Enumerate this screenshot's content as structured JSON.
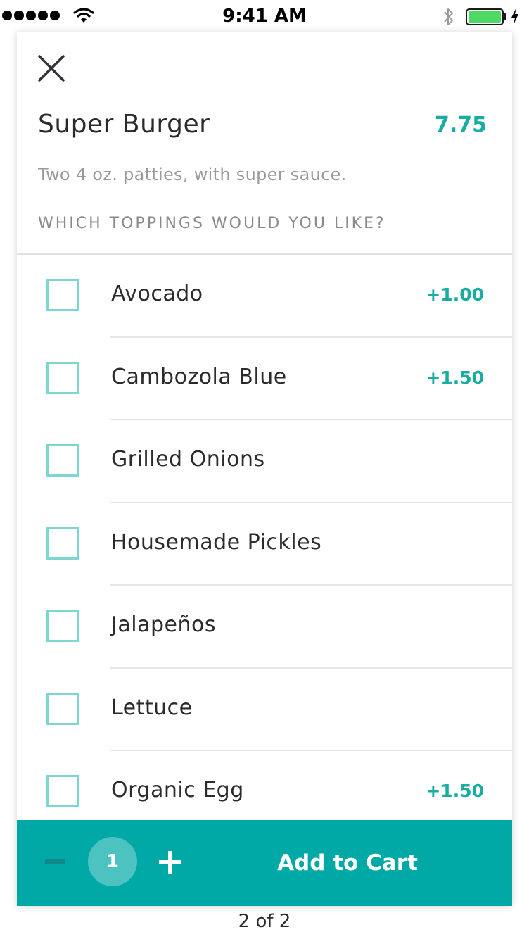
{
  "status_bar": {
    "time": "9:41 AM",
    "signal_bars": 5,
    "battery_level_percent": 100,
    "icons": [
      "signal-dots-icon",
      "wifi-icon",
      "bluetooth-icon",
      "battery-icon",
      "charging-bolt-icon"
    ]
  },
  "item": {
    "name": "Super Burger",
    "price": "7.75",
    "description": "Two 4 oz. patties, with super sauce.",
    "toppings_heading": "WHICH TOPPINGS WOULD YOU LIKE?"
  },
  "toppings": [
    {
      "label": "Avocado",
      "price": "+1.00",
      "checked": false
    },
    {
      "label": "Cambozola Blue",
      "price": "+1.50",
      "checked": false
    },
    {
      "label": "Grilled Onions",
      "price": "",
      "checked": false
    },
    {
      "label": "Housemade Pickles",
      "price": "",
      "checked": false
    },
    {
      "label": "Jalapeños",
      "price": "",
      "checked": false
    },
    {
      "label": "Lettuce",
      "price": "",
      "checked": false
    },
    {
      "label": "Organic Egg",
      "price": "+1.50",
      "checked": false
    }
  ],
  "cart_bar": {
    "quantity": "1",
    "add_label": "Add to Cart"
  },
  "pager": "2 of 2",
  "colors": {
    "accent": "#1aaca0",
    "cart_bar": "#00a9a6",
    "checkbox_border": "#7dd6cf",
    "battery": "#4cd964"
  }
}
